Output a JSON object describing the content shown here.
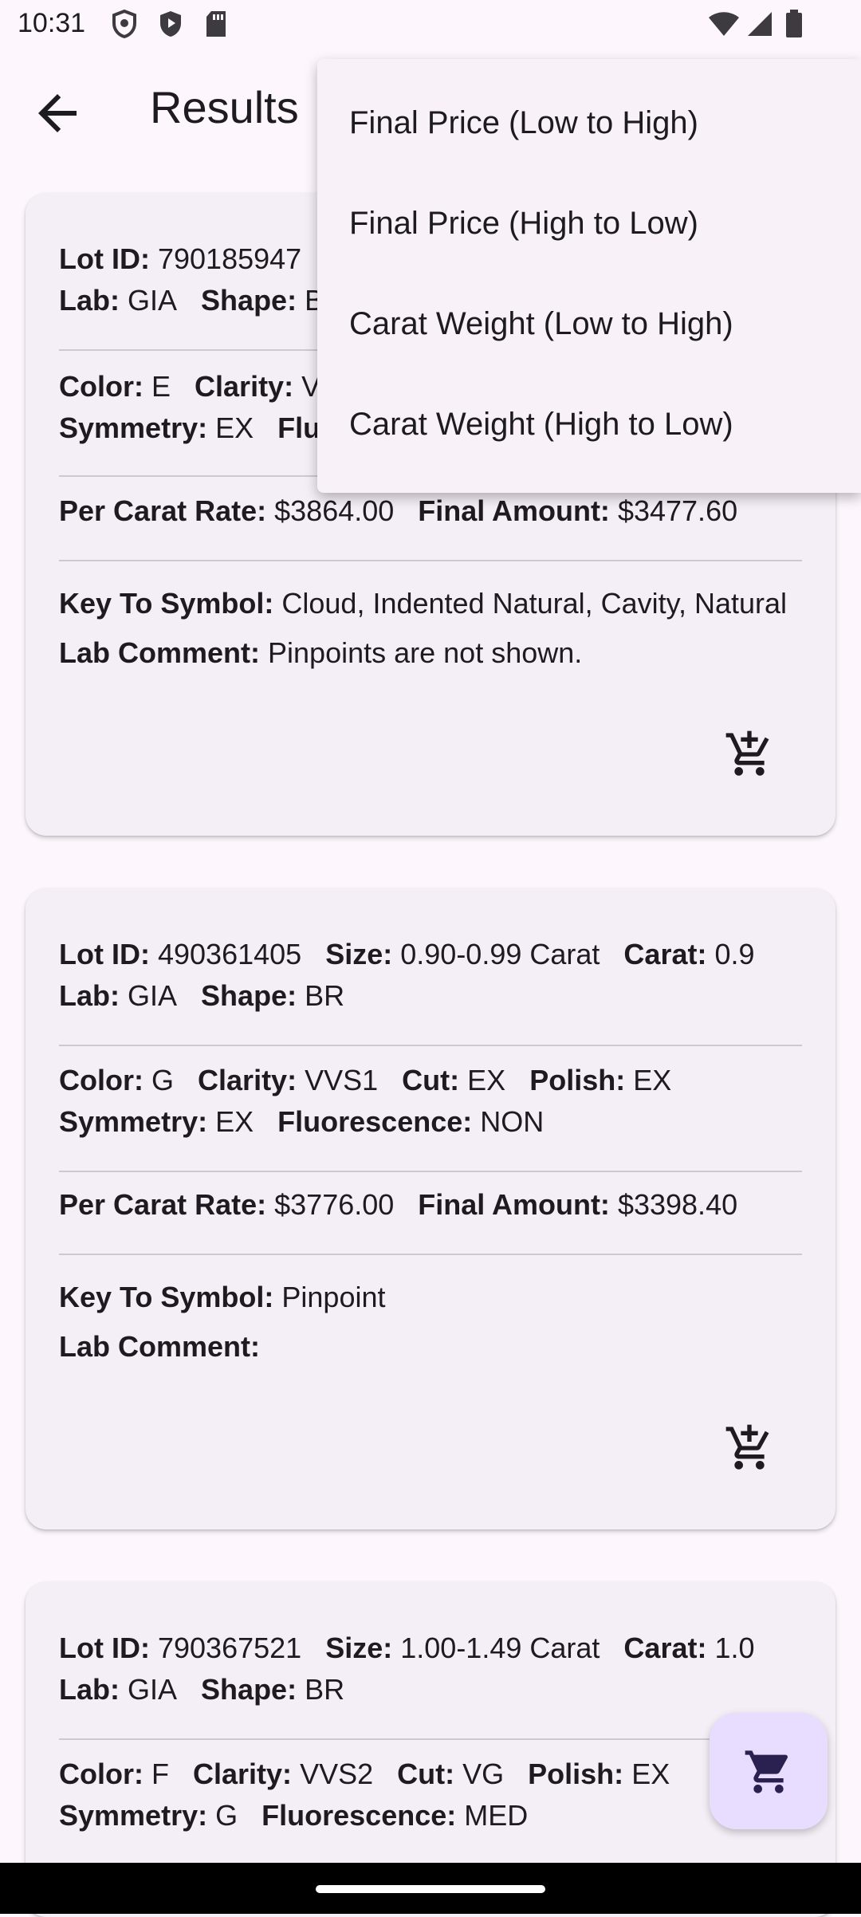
{
  "status_bar": {
    "time": "10:31",
    "icons": [
      "shield-icon",
      "play-protect-icon",
      "sd-card-icon",
      "wifi-icon",
      "signal-icon",
      "battery-icon"
    ]
  },
  "app_bar": {
    "title": "Results",
    "back_icon": "arrow-back-icon"
  },
  "sort_menu": {
    "items": [
      "Final Price (Low to High)",
      "Final Price (High to Low)",
      "Carat Weight (Low to High)",
      "Carat Weight (High to Low)"
    ]
  },
  "labels": {
    "lot_id": "Lot ID:",
    "size": "Size:",
    "carat": "Carat:",
    "lab": "Lab:",
    "shape": "Shape:",
    "color": "Color:",
    "clarity": "Clarity:",
    "cut": "Cut:",
    "polish": "Polish:",
    "symmetry": "Symmetry:",
    "fluorescence": "Fluorescence:",
    "per_carat_rate": "Per Carat Rate:",
    "final_amount": "Final Amount:",
    "key_to_symbol": "Key To Symbol:",
    "lab_comment": "Lab Comment:"
  },
  "cards": [
    {
      "lot_id": "790185947",
      "lab": "GIA",
      "shape": "BR",
      "color": "E",
      "clarity_partial": "VV",
      "symmetry": "EX",
      "fluor_partial": "Fluo",
      "per_carat_rate": "$3864.00",
      "final_amount": "$3477.60",
      "key_to_symbol": "Cloud, Indented Natural, Cavity, Natural",
      "lab_comment": "Pinpoints are not shown."
    },
    {
      "lot_id": "490361405",
      "size": "0.90-0.99 Carat",
      "carat": "0.9",
      "lab": "GIA",
      "shape": "BR",
      "color": "G",
      "clarity": "VVS1",
      "cut": "EX",
      "polish": "EX",
      "symmetry": "EX",
      "fluorescence": "NON",
      "per_carat_rate": "$3776.00",
      "final_amount": "$3398.40",
      "key_to_symbol": "Pinpoint",
      "lab_comment": ""
    },
    {
      "lot_id": "790367521",
      "size": "1.00-1.49 Carat",
      "carat": "1.0",
      "lab": "GIA",
      "shape": "BR",
      "color": "F",
      "clarity": "VVS2",
      "cut": "VG",
      "polish": "EX",
      "symmetry": "G",
      "fluorescence": "MED"
    }
  ],
  "fab": {
    "icon": "cart-icon"
  },
  "colors": {
    "background": "#fdf7fd",
    "card": "#f4eef6",
    "menu": "#f8f1f8",
    "fab": "#e9ddff"
  }
}
